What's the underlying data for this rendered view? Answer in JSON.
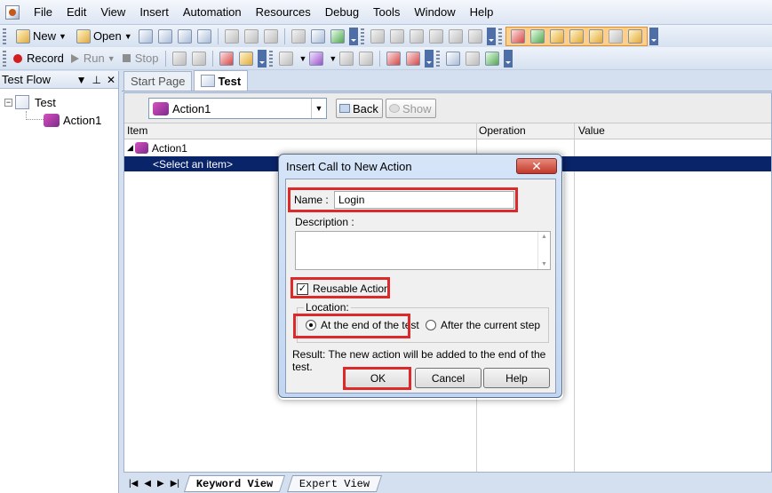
{
  "menu": [
    "File",
    "Edit",
    "View",
    "Insert",
    "Automation",
    "Resources",
    "Debug",
    "Tools",
    "Window",
    "Help"
  ],
  "toolbar": {
    "new_label": "New",
    "open_label": "Open",
    "record_label": "Record",
    "run_label": "Run",
    "stop_label": "Stop"
  },
  "test_flow": {
    "title": "Test Flow",
    "tree": {
      "root": "Test",
      "child": "Action1"
    }
  },
  "tabs": [
    "Start Page",
    "Test"
  ],
  "action_bar": {
    "selected_action": "Action1",
    "back_label": "Back",
    "show_label": "Show"
  },
  "grid": {
    "columns": [
      "Item",
      "Operation",
      "Value"
    ],
    "rows": [
      "Action1",
      "<Select an item>"
    ]
  },
  "bottom_tabs": [
    "Keyword View",
    "Expert View"
  ],
  "dialog": {
    "title": "Insert Call to New Action",
    "name_label": "Name :",
    "name_value": "Login",
    "description_label": "Description :",
    "reusable_label": "Reusable Action",
    "reusable_checked": true,
    "location_label": "Location:",
    "location_options": [
      "At the end of the test",
      "After the current step"
    ],
    "location_selected": "At the end of the test",
    "result_text": "Result: The new action will be added to the end of the test.",
    "ok_label": "OK",
    "cancel_label": "Cancel",
    "help_label": "Help"
  },
  "colors": {
    "selection": "#0a246a",
    "highlight_border": "#dc2a2a",
    "toolbar_highlight": "#ffcf8a"
  }
}
